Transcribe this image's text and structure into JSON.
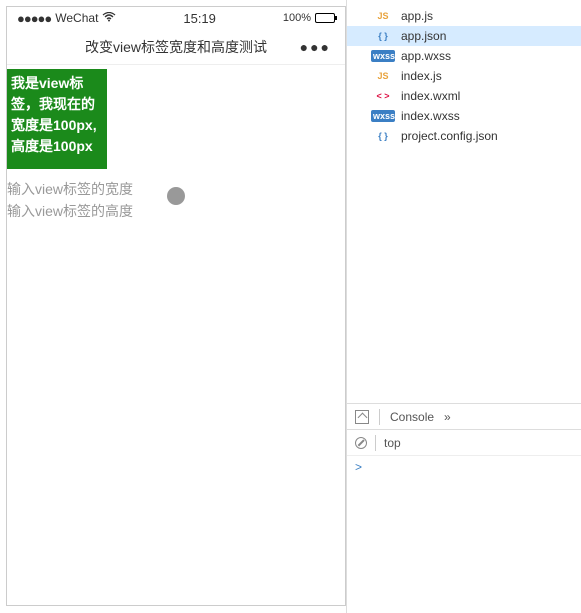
{
  "statusBar": {
    "carrier": "WeChat",
    "signalDots": "●●●●●",
    "wifiGlyph": "⬿",
    "time": "15:19",
    "batteryPct": "100%"
  },
  "titleBar": {
    "title": "改变view标签宽度和高度测试",
    "menuGlyph": "●●●"
  },
  "content": {
    "greenBoxText": "我是view标签，我现在的宽度是100px,高度是100px",
    "widthPlaceholder": "输入view标签的宽度",
    "heightPlaceholder": "输入view标签的高度"
  },
  "files": [
    {
      "icon": "JS",
      "iconClass": "ic-js",
      "name": "app.js",
      "selected": false
    },
    {
      "icon": "{ }",
      "iconClass": "ic-json",
      "name": "app.json",
      "selected": true
    },
    {
      "icon": "wxss",
      "iconClass": "ic-wxss",
      "name": "app.wxss",
      "selected": false
    },
    {
      "icon": "JS",
      "iconClass": "ic-js",
      "name": "index.js",
      "selected": false
    },
    {
      "icon": "< >",
      "iconClass": "ic-wxml",
      "name": "index.wxml",
      "selected": false
    },
    {
      "icon": "wxss",
      "iconClass": "ic-wxss",
      "name": "index.wxss",
      "selected": false
    },
    {
      "icon": "{ }",
      "iconClass": "ic-json",
      "name": "project.config.json",
      "selected": false
    }
  ],
  "console": {
    "tabLabel": "Console",
    "moreGlyph": "»",
    "contextLabel": "top",
    "promptGlyph": ">"
  }
}
